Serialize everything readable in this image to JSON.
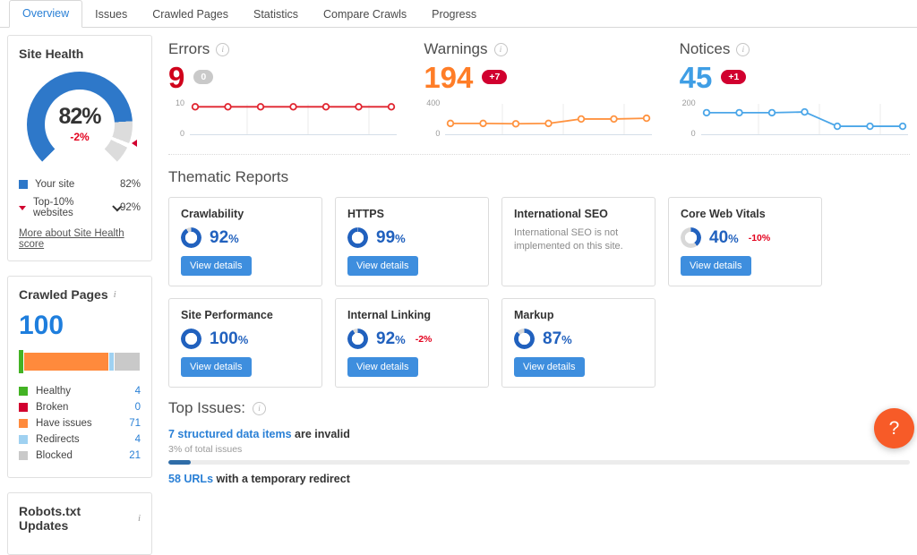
{
  "tabs": [
    {
      "label": "Overview",
      "active": true
    },
    {
      "label": "Issues",
      "active": false
    },
    {
      "label": "Crawled Pages",
      "active": false
    },
    {
      "label": "Statistics",
      "active": false
    },
    {
      "label": "Compare Crawls",
      "active": false
    },
    {
      "label": "Progress",
      "active": false
    }
  ],
  "site_health": {
    "title": "Site Health",
    "score": 82,
    "score_label": "82%",
    "delta": "-2%",
    "benchmark": 92,
    "legend": [
      {
        "label": "Your site",
        "value": "82%",
        "marker": "blue-square",
        "chevron": false
      },
      {
        "label": "Top-10% websites",
        "value": "92%",
        "marker": "red-triangle",
        "chevron": true
      }
    ],
    "link": "More about Site Health score",
    "colors": {
      "arc": "#2e78c9",
      "arc_rest": "#dcdcdc",
      "delta": "#e3001d"
    }
  },
  "metrics": [
    {
      "id": "errors",
      "title": "Errors",
      "value": "9",
      "badge": "0",
      "badge_type": "neutral",
      "color": "#d0021b",
      "line_color": "#e0242f",
      "chart": {
        "type": "line",
        "ymax": 10,
        "y_top_label": "10",
        "y_bottom_label": "0",
        "points": [
          9,
          9,
          9,
          9,
          9,
          9,
          9
        ]
      }
    },
    {
      "id": "warnings",
      "title": "Warnings",
      "value": "194",
      "badge": "+7",
      "badge_type": "negative",
      "color": "#ff7d27",
      "line_color": "#ff9340",
      "chart": {
        "type": "line",
        "ymax": 400,
        "y_top_label": "400",
        "y_bottom_label": "0",
        "points": [
          135,
          135,
          130,
          135,
          195,
          195,
          205
        ]
      }
    },
    {
      "id": "notices",
      "title": "Notices",
      "value": "45",
      "badge": "+1",
      "badge_type": "negative",
      "color": "#3f9ee5",
      "line_color": "#4ba6e8",
      "chart": {
        "type": "line",
        "ymax": 200,
        "y_top_label": "200",
        "y_bottom_label": "0",
        "points": [
          140,
          140,
          140,
          145,
          48,
          48,
          48
        ]
      }
    }
  ],
  "thematic": {
    "title": "Thematic Reports",
    "button_label": "View details",
    "donut_color": "#2161be",
    "donut_rest_color": "#d8d8d8",
    "rows": [
      [
        {
          "title": "Crawlability",
          "percent": 92,
          "percent_label": "92%",
          "delta": "",
          "has_button": true
        },
        {
          "title": "HTTPS",
          "percent": 99,
          "percent_label": "99%",
          "delta": "",
          "has_button": true
        },
        {
          "title": "International SEO",
          "note": "International SEO is not implemented on this site.",
          "has_button": false
        },
        {
          "title": "Core Web Vitals",
          "percent": 40,
          "percent_label": "40%",
          "delta": "-10%",
          "has_button": true
        }
      ],
      [
        {
          "title": "Site Performance",
          "percent": 100,
          "percent_label": "100%",
          "delta": "",
          "has_button": true
        },
        {
          "title": "Internal Linking",
          "percent": 92,
          "percent_label": "92%",
          "delta": "-2%",
          "has_button": true
        },
        {
          "title": "Markup",
          "percent": 87,
          "percent_label": "87%",
          "delta": "",
          "has_button": true
        }
      ]
    ]
  },
  "crawled_pages": {
    "title": "Crawled Pages",
    "total": "100",
    "segments": [
      {
        "label": "Healthy",
        "value": 4,
        "color": "#43b324"
      },
      {
        "label": "Broken",
        "value": 0,
        "color": "#d1002f"
      },
      {
        "label": "Have issues",
        "value": 71,
        "color": "#ff8a3c"
      },
      {
        "label": "Redirects",
        "value": 4,
        "color": "#9fd1f1"
      },
      {
        "label": "Blocked",
        "value": 21,
        "color": "#c9c9c9"
      }
    ]
  },
  "robots": {
    "title": "Robots.txt Updates"
  },
  "top_issues": {
    "title": "Top Issues:",
    "items": [
      {
        "link": "7 structured data items",
        "rest": " are invalid",
        "sub": "3% of total issues",
        "progress_pct": 3
      },
      {
        "link": "58 URLs",
        "rest": " with a temporary redirect",
        "sub": "",
        "progress_pct": null
      }
    ]
  },
  "help_button": "?"
}
